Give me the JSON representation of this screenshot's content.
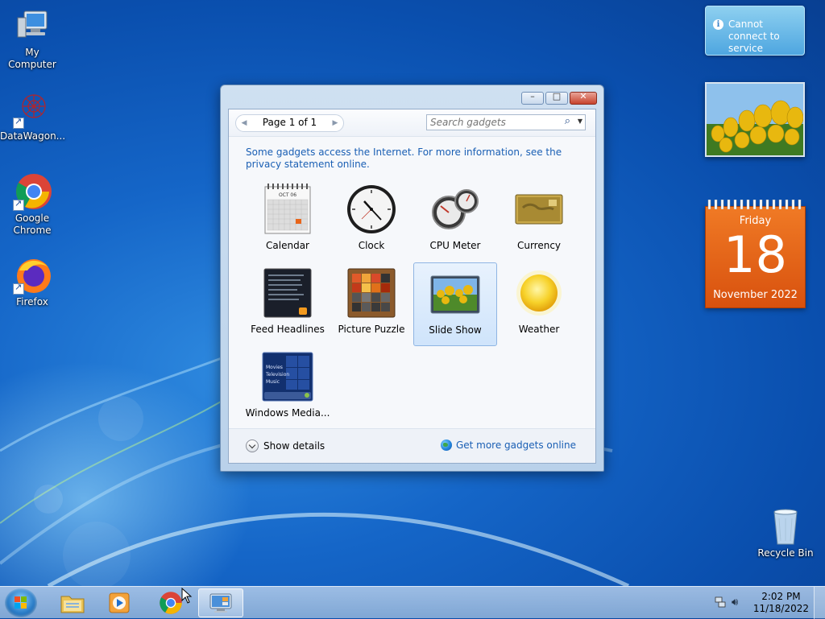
{
  "desktop": {
    "icons": [
      {
        "label": "My Computer"
      },
      {
        "label": "DataWagon..."
      },
      {
        "label": "Google Chrome"
      },
      {
        "label": "Firefox"
      },
      {
        "label": "Recycle Bin"
      }
    ]
  },
  "gadget_window": {
    "pager_text": "Page 1 of 1",
    "search_placeholder": "Search gadgets",
    "info_text": "Some gadgets access the Internet.  For more information, see the privacy statement online.",
    "gadgets": [
      {
        "label": "Calendar",
        "icon": "calendar-thumb"
      },
      {
        "label": "Clock",
        "icon": "clock-thumb"
      },
      {
        "label": "CPU Meter",
        "icon": "cpu-meter-thumb"
      },
      {
        "label": "Currency",
        "icon": "currency-thumb"
      },
      {
        "label": "Feed Headlines",
        "icon": "feed-headlines-thumb"
      },
      {
        "label": "Picture Puzzle",
        "icon": "picture-puzzle-thumb"
      },
      {
        "label": "Slide Show",
        "icon": "slide-show-thumb",
        "selected": true
      },
      {
        "label": "Weather",
        "icon": "weather-thumb"
      },
      {
        "label": "Windows Media...",
        "icon": "windows-media-thumb"
      }
    ],
    "show_details_label": "Show details",
    "get_more_label": "Get more gadgets online",
    "calendar_thumb_month": "OCT 06",
    "media_thumb_lines": [
      "Movies",
      "Television",
      "Music"
    ]
  },
  "side_gadgets": {
    "notification": "Cannot connect to service",
    "calendar": {
      "weekday": "Friday",
      "day": "18",
      "month_year": "November 2022"
    }
  },
  "taskbar": {
    "pinned": [
      {
        "name": "windows-explorer",
        "active": false
      },
      {
        "name": "windows-media-player",
        "active": false
      },
      {
        "name": "google-chrome",
        "active": false
      },
      {
        "name": "desktop-gadgets",
        "active": true
      }
    ],
    "clock_time": "2:02 PM",
    "clock_date": "11/18/2022"
  },
  "colors": {
    "accent_link": "#1a5fb4",
    "calendar_orange": "#e8651a",
    "desktop_blue": "#1566c8"
  }
}
